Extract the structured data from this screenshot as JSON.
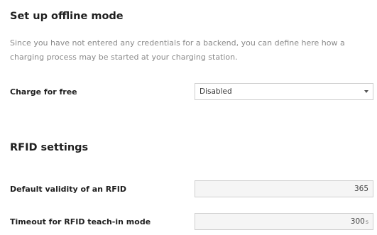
{
  "offline_mode": {
    "title": "Set up offline mode",
    "description": "Since you have not entered any credentials for a backend, you can define here how a charging process may be started at your charging station.",
    "charge_for_free": {
      "label": "Charge for free",
      "value": "Disabled"
    }
  },
  "rfid": {
    "title": "RFID settings",
    "default_validity": {
      "label": "Default validity of an RFID",
      "value": "365"
    },
    "teach_in_timeout": {
      "label": "Timeout for RFID teach-in mode",
      "value": "300",
      "unit": "s"
    }
  }
}
